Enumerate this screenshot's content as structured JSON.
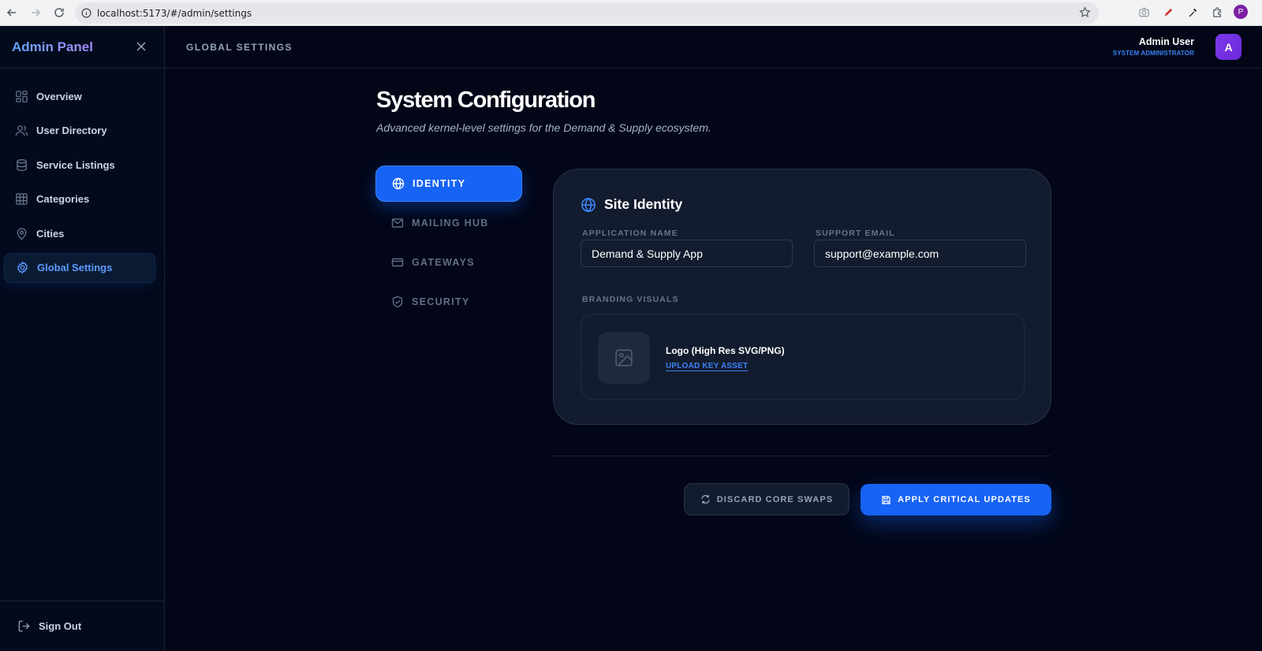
{
  "browser": {
    "url": "localhost:5173/#/admin/settings",
    "profile_initial": "P"
  },
  "sidebar": {
    "brand": "Admin Panel",
    "items": [
      {
        "label": "Overview",
        "icon": "layout-grid-icon"
      },
      {
        "label": "User Directory",
        "icon": "users-icon"
      },
      {
        "label": "Service Listings",
        "icon": "database-icon"
      },
      {
        "label": "Categories",
        "icon": "grid-icon"
      },
      {
        "label": "Cities",
        "icon": "map-pin-icon"
      },
      {
        "label": "Global Settings",
        "icon": "gear-icon",
        "active": true
      }
    ],
    "sign_out": "Sign Out"
  },
  "header": {
    "title": "GLOBAL SETTINGS",
    "user_name": "Admin User",
    "user_role": "SYSTEM ADMINISTRATOR",
    "avatar_initial": "A"
  },
  "page": {
    "title": "System Configuration",
    "subtitle": "Advanced kernel-level settings for the Demand & Supply ecosystem."
  },
  "tabs": [
    {
      "label": "IDENTITY",
      "icon": "globe-icon",
      "active": true
    },
    {
      "label": "MAILING HUB",
      "icon": "mail-icon"
    },
    {
      "label": "GATEWAYS",
      "icon": "credit-card-icon"
    },
    {
      "label": "SECURITY",
      "icon": "shield-check-icon"
    }
  ],
  "identity": {
    "heading": "Site Identity",
    "app_name_label": "APPLICATION NAME",
    "app_name_value": "Demand & Supply App",
    "support_email_label": "SUPPORT EMAIL",
    "support_email_value": "support@example.com",
    "branding_label": "BRANDING VISUALS",
    "logo_title": "Logo (High Res SVG/PNG)",
    "upload_label": "UPLOAD KEY ASSET"
  },
  "actions": {
    "discard": "DISCARD CORE SWAPS",
    "apply": "APPLY CRITICAL UPDATES"
  },
  "colors": {
    "background": "#020617",
    "accent": "#1763f5",
    "card": "#131c2e"
  }
}
